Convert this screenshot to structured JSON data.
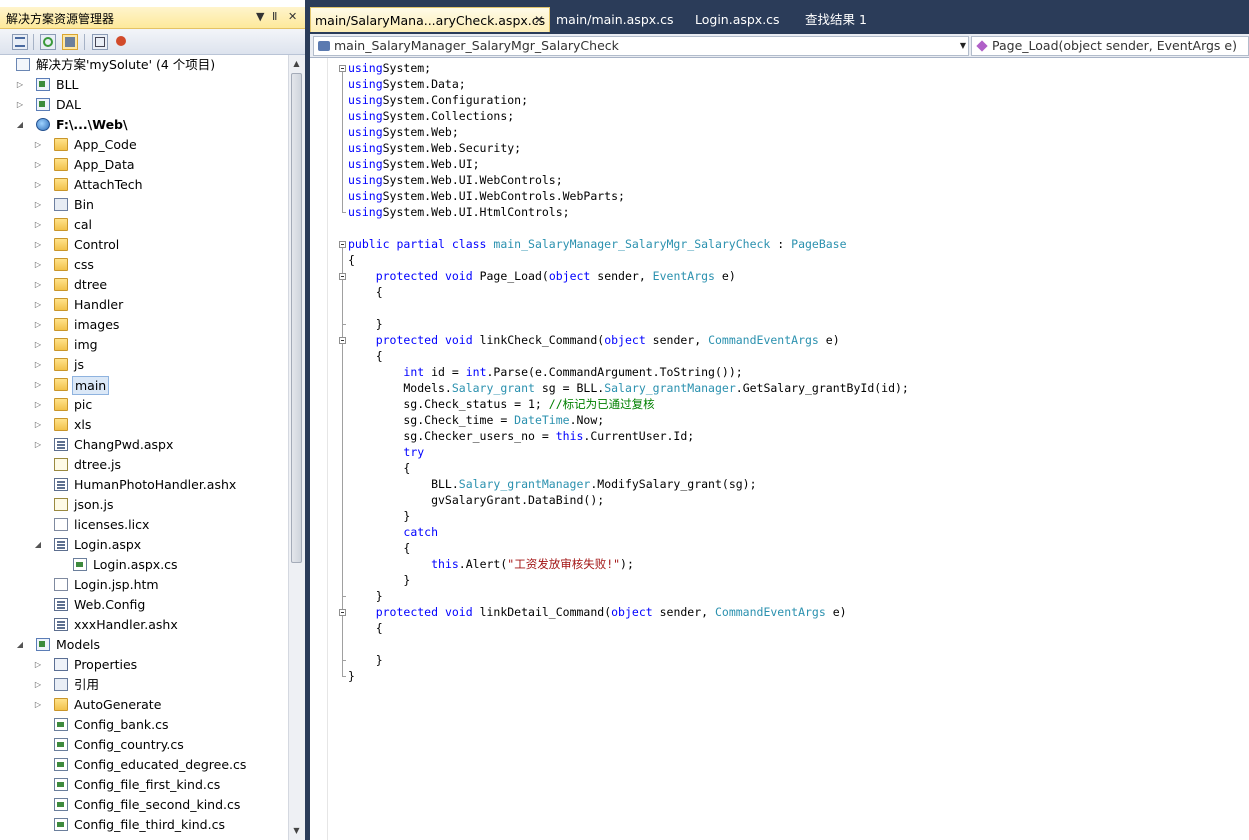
{
  "solution_explorer": {
    "title": "解决方案资源管理器",
    "controls": [
      "▼",
      "Ⅱ",
      "✕"
    ],
    "toolbar_icons": [
      "properties-icon",
      "refresh-icon",
      "show-all-files-icon",
      "view-code-icon",
      "view-designer-icon"
    ],
    "items": [
      {
        "label": "解决方案'mySolute' (4 个项目)",
        "icon": "solution-icon",
        "depth": 0,
        "arrow": ""
      },
      {
        "label": "BLL",
        "icon": "project-icon",
        "depth": 0,
        "arrow": "▷"
      },
      {
        "label": "DAL",
        "icon": "project-icon",
        "depth": 0,
        "arrow": "▷"
      },
      {
        "label": "F:\\...\\Web\\",
        "icon": "web-project-icon",
        "depth": 0,
        "arrow": "◢",
        "bold": true
      },
      {
        "label": "App_Code",
        "icon": "folder-icon",
        "depth": 1,
        "arrow": "▷"
      },
      {
        "label": "App_Data",
        "icon": "folder-icon",
        "depth": 1,
        "arrow": "▷"
      },
      {
        "label": "AttachTech",
        "icon": "folder-icon",
        "depth": 1,
        "arrow": "▷"
      },
      {
        "label": "Bin",
        "icon": "bin-folder-icon",
        "depth": 1,
        "arrow": "▷"
      },
      {
        "label": "cal",
        "icon": "folder-icon",
        "depth": 1,
        "arrow": "▷"
      },
      {
        "label": "Control",
        "icon": "folder-icon",
        "depth": 1,
        "arrow": "▷"
      },
      {
        "label": "css",
        "icon": "folder-icon",
        "depth": 1,
        "arrow": "▷"
      },
      {
        "label": "dtree",
        "icon": "folder-icon",
        "depth": 1,
        "arrow": "▷"
      },
      {
        "label": "Handler",
        "icon": "folder-icon",
        "depth": 1,
        "arrow": "▷"
      },
      {
        "label": "images",
        "icon": "folder-icon",
        "depth": 1,
        "arrow": "▷"
      },
      {
        "label": "img",
        "icon": "folder-icon",
        "depth": 1,
        "arrow": "▷"
      },
      {
        "label": "js",
        "icon": "folder-icon",
        "depth": 1,
        "arrow": "▷"
      },
      {
        "label": "main",
        "icon": "folder-icon",
        "depth": 1,
        "arrow": "▷",
        "selected": true
      },
      {
        "label": "pic",
        "icon": "folder-icon",
        "depth": 1,
        "arrow": "▷"
      },
      {
        "label": "xls",
        "icon": "folder-icon",
        "depth": 1,
        "arrow": "▷"
      },
      {
        "label": "ChangPwd.aspx",
        "icon": "aspx-file-icon",
        "depth": 1,
        "arrow": "▷"
      },
      {
        "label": "dtree.js",
        "icon": "js-file-icon",
        "depth": 1,
        "arrow": ""
      },
      {
        "label": "HumanPhotoHandler.ashx",
        "icon": "ashx-file-icon",
        "depth": 1,
        "arrow": ""
      },
      {
        "label": "json.js",
        "icon": "js-file-icon",
        "depth": 1,
        "arrow": ""
      },
      {
        "label": "licenses.licx",
        "icon": "file-icon",
        "depth": 1,
        "arrow": ""
      },
      {
        "label": "Login.aspx",
        "icon": "aspx-file-icon",
        "depth": 1,
        "arrow": "◢"
      },
      {
        "label": "Login.aspx.cs",
        "icon": "cs-file-icon",
        "depth": 2,
        "arrow": ""
      },
      {
        "label": "Login.jsp.htm",
        "icon": "htm-file-icon",
        "depth": 1,
        "arrow": ""
      },
      {
        "label": "Web.Config",
        "icon": "config-file-icon",
        "depth": 1,
        "arrow": ""
      },
      {
        "label": "xxxHandler.ashx",
        "icon": "ashx-file-icon",
        "depth": 1,
        "arrow": ""
      },
      {
        "label": "Models",
        "icon": "project-icon",
        "depth": 0,
        "arrow": "◢"
      },
      {
        "label": "Properties",
        "icon": "properties-folder-icon",
        "depth": 1,
        "arrow": "▷"
      },
      {
        "label": "引用",
        "icon": "references-icon",
        "depth": 1,
        "arrow": "▷"
      },
      {
        "label": "AutoGenerate",
        "icon": "folder-icon",
        "depth": 1,
        "arrow": "▷"
      },
      {
        "label": "Config_bank.cs",
        "icon": "cs-file-icon",
        "depth": 1,
        "arrow": ""
      },
      {
        "label": "Config_country.cs",
        "icon": "cs-file-icon",
        "depth": 1,
        "arrow": ""
      },
      {
        "label": "Config_educated_degree.cs",
        "icon": "cs-file-icon",
        "depth": 1,
        "arrow": ""
      },
      {
        "label": "Config_file_first_kind.cs",
        "icon": "cs-file-icon",
        "depth": 1,
        "arrow": ""
      },
      {
        "label": "Config_file_second_kind.cs",
        "icon": "cs-file-icon",
        "depth": 1,
        "arrow": ""
      },
      {
        "label": "Config_file_third_kind.cs",
        "icon": "cs-file-icon",
        "depth": 1,
        "arrow": ""
      }
    ]
  },
  "tabs": [
    {
      "label": "main/SalaryMana...aryCheck.aspx.cs",
      "active": true,
      "close": "✕"
    },
    {
      "label": "main/main.aspx.cs",
      "active": false
    },
    {
      "label": "Login.aspx.cs",
      "active": false
    },
    {
      "label": "查找结果 1",
      "active": false
    }
  ],
  "nav": {
    "class_combo": "main_SalaryManager_SalaryMgr_SalaryCheck",
    "member_combo": "Page_Load(object sender, EventArgs e)"
  },
  "code_lines": [
    [
      [
        "kw",
        "using"
      ],
      [
        "",
        "System;"
      ]
    ],
    [
      [
        "kw",
        "using"
      ],
      [
        "",
        "System.Data;"
      ]
    ],
    [
      [
        "kw",
        "using"
      ],
      [
        "",
        "System.Configuration;"
      ]
    ],
    [
      [
        "kw",
        "using"
      ],
      [
        "",
        "System.Collections;"
      ]
    ],
    [
      [
        "kw",
        "using"
      ],
      [
        "",
        "System.Web;"
      ]
    ],
    [
      [
        "kw",
        "using"
      ],
      [
        "",
        "System.Web.Security;"
      ]
    ],
    [
      [
        "kw",
        "using"
      ],
      [
        "",
        "System.Web.UI;"
      ]
    ],
    [
      [
        "kw",
        "using"
      ],
      [
        "",
        "System.Web.UI.WebControls;"
      ]
    ],
    [
      [
        "kw",
        "using"
      ],
      [
        "",
        "System.Web.UI.WebControls.WebParts;"
      ]
    ],
    [
      [
        "kw",
        "using"
      ],
      [
        "",
        "System.Web.UI.HtmlControls;"
      ]
    ],
    [],
    [
      [
        "kw",
        "public partial class "
      ],
      [
        "ty",
        "main_SalaryManager_SalaryMgr_SalaryCheck"
      ],
      [
        "",
        " : "
      ],
      [
        "ty",
        "PageBase"
      ]
    ],
    [
      [
        "",
        "{"
      ]
    ],
    [
      [
        "",
        "    "
      ],
      [
        "kw",
        "protected void"
      ],
      [
        "",
        " Page_Load("
      ],
      [
        "kw",
        "object"
      ],
      [
        "",
        " sender, "
      ],
      [
        "ty",
        "EventArgs"
      ],
      [
        "",
        " e)"
      ]
    ],
    [
      [
        "",
        "    {"
      ]
    ],
    [],
    [
      [
        "",
        "    }"
      ]
    ],
    [
      [
        "",
        "    "
      ],
      [
        "kw",
        "protected void"
      ],
      [
        "",
        " linkCheck_Command("
      ],
      [
        "kw",
        "object"
      ],
      [
        "",
        " sender, "
      ],
      [
        "ty",
        "CommandEventArgs"
      ],
      [
        "",
        " e)"
      ]
    ],
    [
      [
        "",
        "    {"
      ]
    ],
    [
      [
        "",
        "        "
      ],
      [
        "kw",
        "int"
      ],
      [
        "",
        " id = "
      ],
      [
        "kw",
        "int"
      ],
      [
        "",
        ".Parse(e.CommandArgument.ToString());"
      ]
    ],
    [
      [
        "",
        "        Models."
      ],
      [
        "ty",
        "Salary_grant"
      ],
      [
        "",
        " sg = BLL."
      ],
      [
        "ty",
        "Salary_grantManager"
      ],
      [
        "",
        ".GetSalary_grantById(id);"
      ]
    ],
    [
      [
        "",
        "        sg.Check_status = 1; "
      ],
      [
        "cm",
        "//标记为已通过复核"
      ]
    ],
    [
      [
        "",
        "        sg.Check_time = "
      ],
      [
        "ty",
        "DateTime"
      ],
      [
        "",
        ".Now;"
      ]
    ],
    [
      [
        "",
        "        sg.Checker_users_no = "
      ],
      [
        "kw",
        "this"
      ],
      [
        "",
        ".CurrentUser.Id;"
      ]
    ],
    [
      [
        "",
        "        "
      ],
      [
        "kw",
        "try"
      ]
    ],
    [
      [
        "",
        "        {"
      ]
    ],
    [
      [
        "",
        "            BLL."
      ],
      [
        "ty",
        "Salary_grantManager"
      ],
      [
        "",
        ".ModifySalary_grant(sg);"
      ]
    ],
    [
      [
        "",
        "            gvSalaryGrant.DataBind();"
      ]
    ],
    [
      [
        "",
        "        }"
      ]
    ],
    [
      [
        "",
        "        "
      ],
      [
        "kw",
        "catch"
      ]
    ],
    [
      [
        "",
        "        {"
      ]
    ],
    [
      [
        "",
        "            "
      ],
      [
        "kw",
        "this"
      ],
      [
        "",
        ".Alert("
      ],
      [
        "st",
        "\"工资发放审核失败!\""
      ],
      [
        "",
        ");"
      ]
    ],
    [
      [
        "",
        "        }"
      ]
    ],
    [
      [
        "",
        "    }"
      ]
    ],
    [
      [
        "",
        "    "
      ],
      [
        "kw",
        "protected void"
      ],
      [
        "",
        " linkDetail_Command("
      ],
      [
        "kw",
        "object"
      ],
      [
        "",
        " sender, "
      ],
      [
        "ty",
        "CommandEventArgs"
      ],
      [
        "",
        " e)"
      ]
    ],
    [
      [
        "",
        "    {"
      ]
    ],
    [],
    [
      [
        "",
        "    }"
      ]
    ],
    [
      [
        "",
        "}"
      ]
    ]
  ],
  "colors": {
    "keyword": "#0000ff",
    "type": "#2b91af",
    "comment": "#008000",
    "string": "#a31515",
    "chrome": "#2b3c59"
  }
}
